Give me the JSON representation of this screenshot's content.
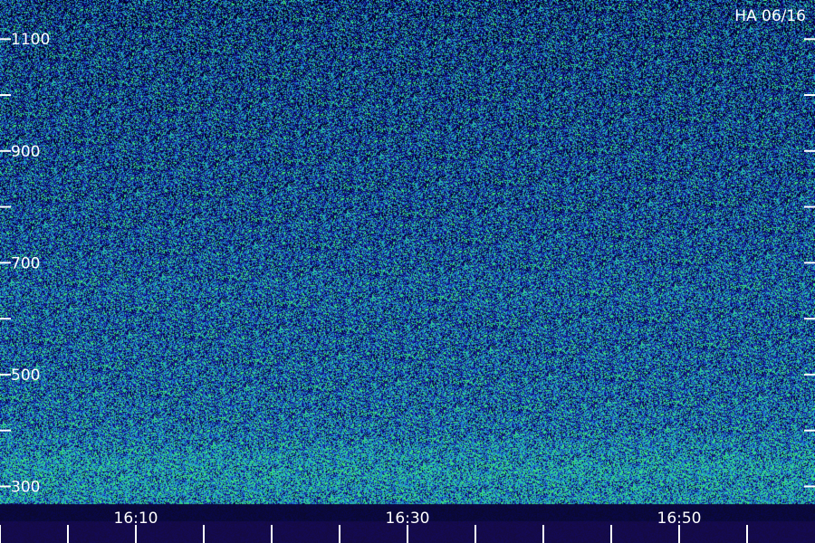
{
  "station_label": "HA 06/16",
  "colors": {
    "background": "#000000",
    "low": "#1a1a8c",
    "mid": "#1e7ad6",
    "high": "#3cf26a",
    "text": "#ffffff",
    "tick": "#ffffff"
  },
  "chart_data": {
    "type": "heatmap",
    "title": "HA 06/16",
    "xlabel": "",
    "ylabel": "",
    "x_tick_labels": [
      "16:10",
      "16:30",
      "16:50"
    ],
    "y_tick_labels": [
      "1100",
      "900",
      "700",
      "500",
      "300"
    ],
    "y_ticks": [
      300,
      400,
      500,
      600,
      700,
      800,
      900,
      1000,
      1100
    ],
    "ylim": [
      270,
      1170
    ],
    "xlim_minutes": [
      "16:00",
      "16:59"
    ],
    "x_minor_ticks_minutes": [
      "16:00",
      "16:05",
      "16:10",
      "16:15",
      "16:20",
      "16:25",
      "16:30",
      "16:35",
      "16:40",
      "16:45",
      "16:50",
      "16:55"
    ],
    "intensity_profile": [
      {
        "y": 300,
        "level": 0.85
      },
      {
        "y": 330,
        "level": 0.95
      },
      {
        "y": 400,
        "level": 0.6
      },
      {
        "y": 500,
        "level": 0.5
      },
      {
        "y": 600,
        "level": 0.42
      },
      {
        "y": 650,
        "level": 0.48
      },
      {
        "y": 700,
        "level": 0.38
      },
      {
        "y": 800,
        "level": 0.3
      },
      {
        "y": 900,
        "level": 0.26
      },
      {
        "y": 1000,
        "level": 0.22
      },
      {
        "y": 1100,
        "level": 0.18
      },
      {
        "y": 1170,
        "level": 0.1
      }
    ],
    "grid": false
  }
}
